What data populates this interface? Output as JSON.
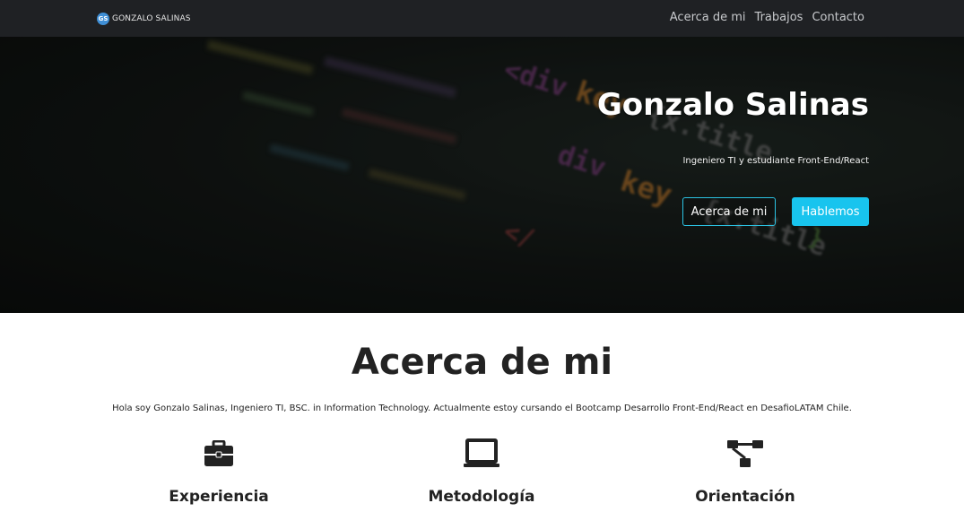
{
  "brand": {
    "logo_text": "GS",
    "name": "GONZALO SALINAS"
  },
  "nav": {
    "items": [
      "Acerca de mi",
      "Trabajos",
      "Contacto"
    ]
  },
  "hero": {
    "title": "Gonzalo Salinas",
    "subtitle": "Ingeniero TI y estudiante Front-End/React",
    "primary_button": "Acerca de mi",
    "secondary_button": "Hablemos"
  },
  "about": {
    "title": "Acerca de mi",
    "text": "Hola soy Gonzalo Salinas, Ingeniero TI, BSC. in Information Technology. Actualmente estoy cursando el Bootcamp Desarrollo Front-End/React en DesafioLATAM Chile.",
    "features": [
      {
        "icon": "briefcase-icon",
        "label": "Experiencia"
      },
      {
        "icon": "laptop-icon",
        "label": "Metodología"
      },
      {
        "icon": "sitemap-icon",
        "label": "Orientación"
      }
    ]
  },
  "colors": {
    "navbar": "#1f2124",
    "accent": "#18c4ee",
    "text": "#222222"
  }
}
